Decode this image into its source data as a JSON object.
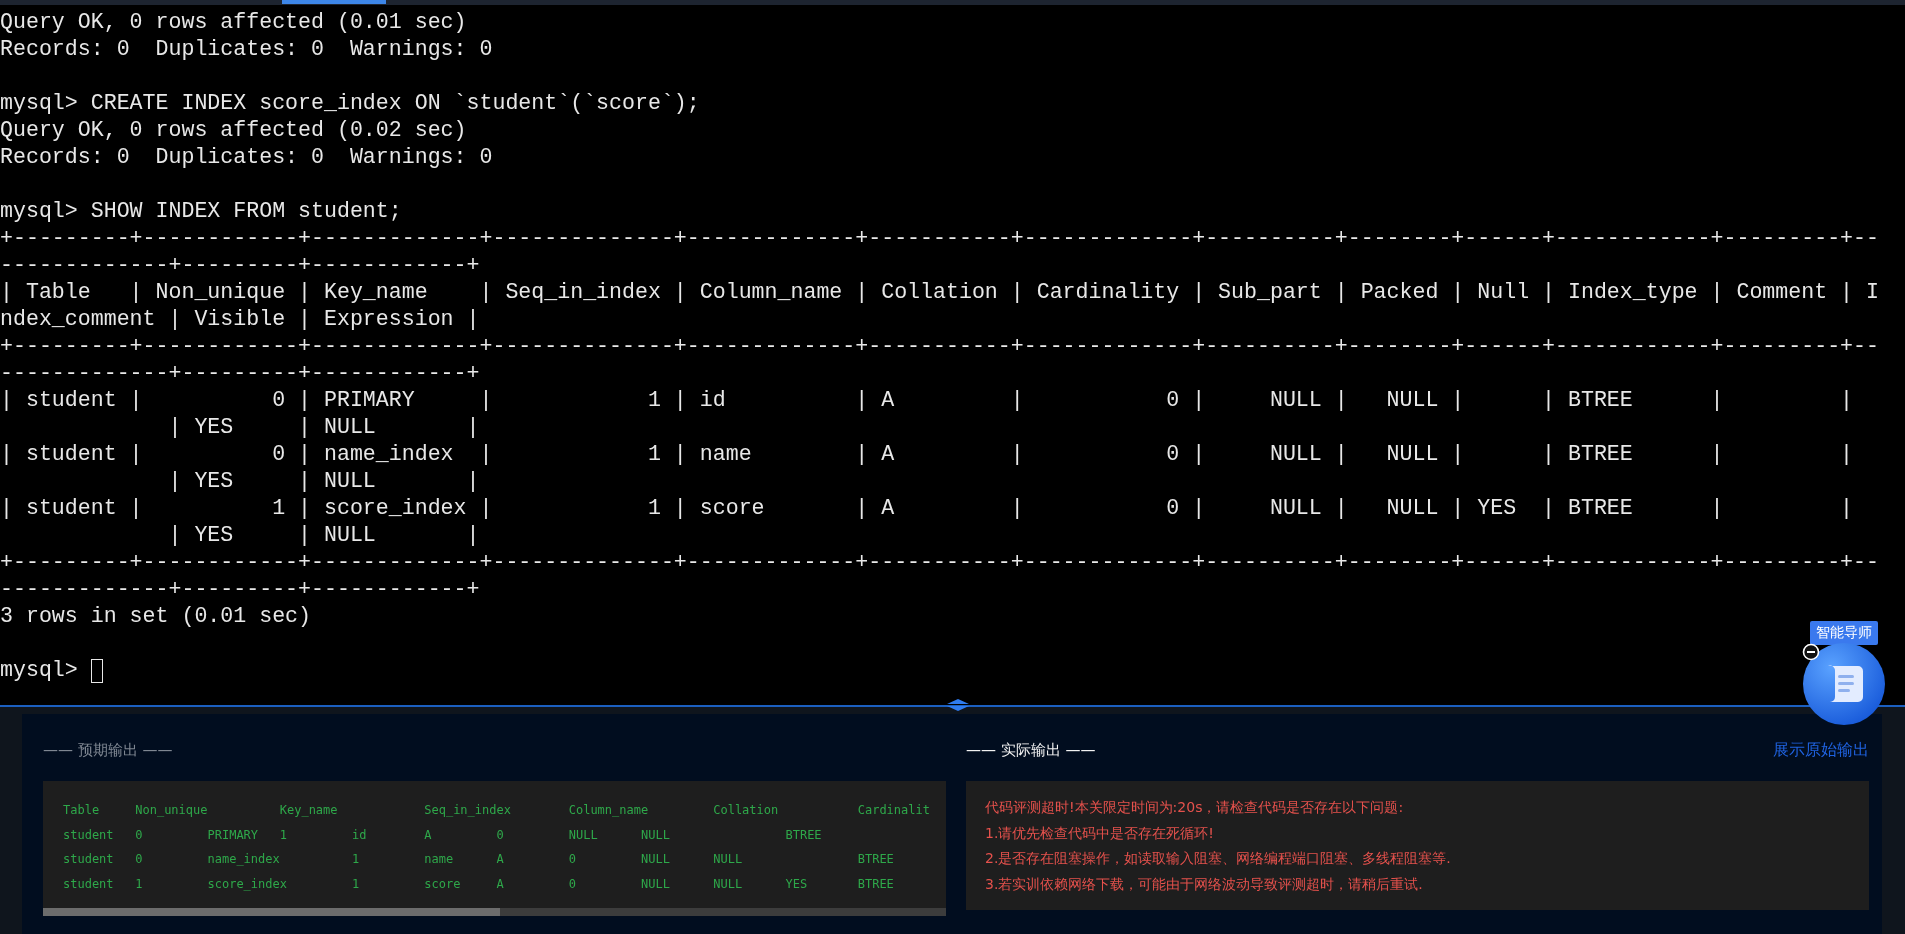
{
  "terminal": {
    "blocks": [
      [
        "Query OK, 0 rows affected (0.01 sec)",
        "Records: 0  Duplicates: 0  Warnings: 0"
      ],
      [
        "mysql> CREATE INDEX score_index ON `student`(`score`);",
        "Query OK, 0 rows affected (0.02 sec)",
        "Records: 0  Duplicates: 0  Warnings: 0"
      ],
      [
        "mysql> SHOW INDEX FROM student;",
        "+---------+------------+-------------+--------------+-------------+-----------+-------------+----------+--------+------+------------+---------+--",
        "-------------+---------+------------+",
        "| Table   | Non_unique | Key_name    | Seq_in_index | Column_name | Collation | Cardinality | Sub_part | Packed | Null | Index_type | Comment | I",
        "ndex_comment | Visible | Expression |",
        "+---------+------------+-------------+--------------+-------------+-----------+-------------+----------+--------+------+------------+---------+--",
        "-------------+---------+------------+",
        "| student |          0 | PRIMARY     |            1 | id          | A         |           0 |     NULL |   NULL |      | BTREE      |         |",
        "             | YES     | NULL       |",
        "| student |          0 | name_index  |            1 | name        | A         |           0 |     NULL |   NULL |      | BTREE      |         |",
        "             | YES     | NULL       |",
        "| student |          1 | score_index |            1 | score       | A         |           0 |     NULL |   NULL | YES  | BTREE      |         |",
        "             | YES     | NULL       |",
        "+---------+------------+-------------+--------------+-------------+-----------+-------------+----------+--------+------+------------+---------+--",
        "-------------+---------+------------+",
        "3 rows in set (0.01 sec)"
      ]
    ],
    "prompt": "mysql>"
  },
  "expected_output": {
    "title": "—— 预期输出 ——",
    "lines": [
      "Table     Non_unique          Key_name            Seq_in_index        Column_name         Collation           Cardinalit",
      "student   0         PRIMARY   1         id        A         0         NULL      NULL                BTREE",
      "student   0         name_index          1         name      A         0         NULL      NULL                BTREE",
      "student   1         score_index         1         score     A         0         NULL      NULL      YES       BTREE"
    ]
  },
  "actual_output": {
    "title": "—— 实际输出 ——",
    "link": "展示原始输出",
    "lines": [
      "代码评测超时!本关限定时间为:20s，请检查代码是否存在以下问题:",
      "1.请优先检查代码中是否存在死循环!",
      "2.是否存在阻塞操作，如读取输入阻塞、网络编程端口阻塞、多线程阻塞等.",
      "3.若实训依赖网络下载，可能由于网络波动导致评测超时，请稍后重试."
    ]
  },
  "assistant": {
    "label": "智能导师"
  }
}
